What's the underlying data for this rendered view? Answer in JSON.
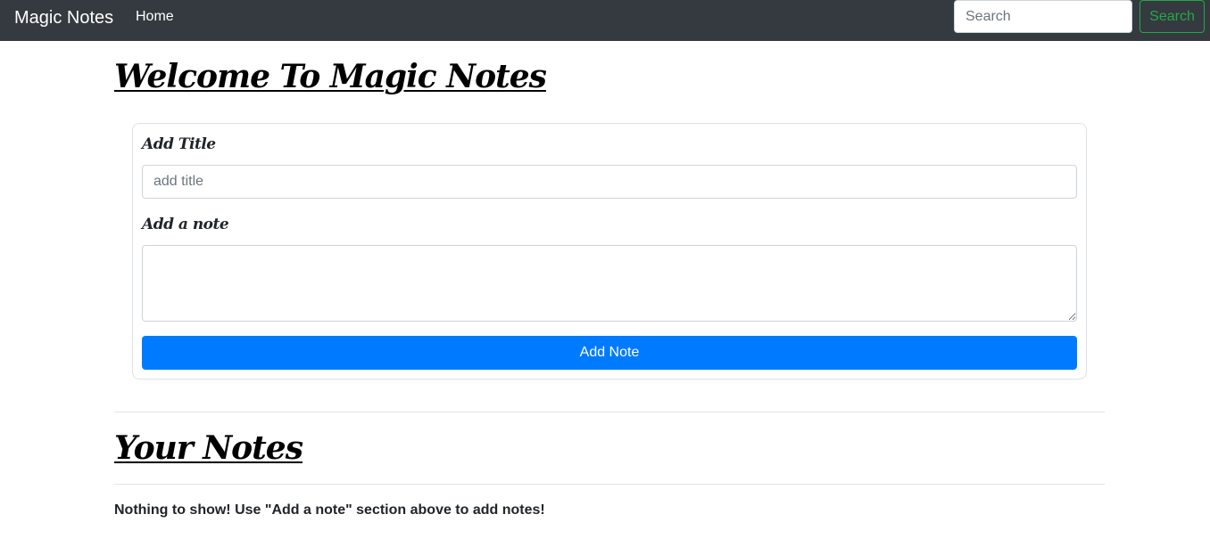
{
  "navbar": {
    "brand": "Magic Notes",
    "home_link": "Home",
    "search_placeholder": "Search",
    "search_button": "Search"
  },
  "main": {
    "welcome_heading": "Welcome To Magic Notes",
    "form": {
      "title_label": "Add Title",
      "title_placeholder": "add title",
      "note_label": "Add a note",
      "note_value": "",
      "add_button": "Add Note"
    },
    "notes_heading": "Your Notes",
    "empty_message": "Nothing to show! Use \"Add a note\" section above to add notes!"
  },
  "colors": {
    "navbar_bg": "#343a40",
    "primary": "#007bff",
    "success": "#28a745"
  }
}
